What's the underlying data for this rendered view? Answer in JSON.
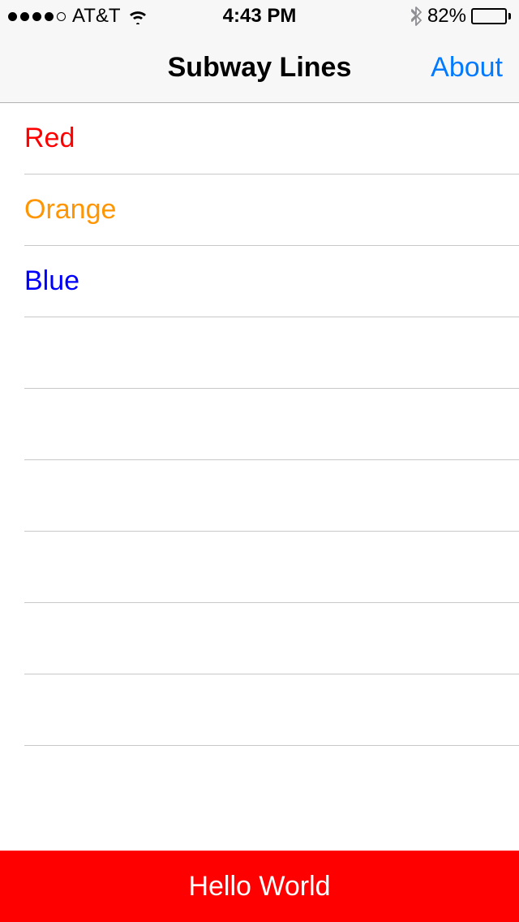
{
  "status": {
    "carrier": "AT&T",
    "time": "4:43 PM",
    "battery_pct": "82%",
    "battery_fill": 82
  },
  "nav": {
    "title": "Subway Lines",
    "right": "About"
  },
  "lines": [
    {
      "name": "Red",
      "color": "#ff0000"
    },
    {
      "name": "Orange",
      "color": "#ff9500"
    },
    {
      "name": "Blue",
      "color": "#0000ff"
    }
  ],
  "empty_rows": 6,
  "footer": {
    "text": "Hello World",
    "bg": "#ff0000"
  }
}
